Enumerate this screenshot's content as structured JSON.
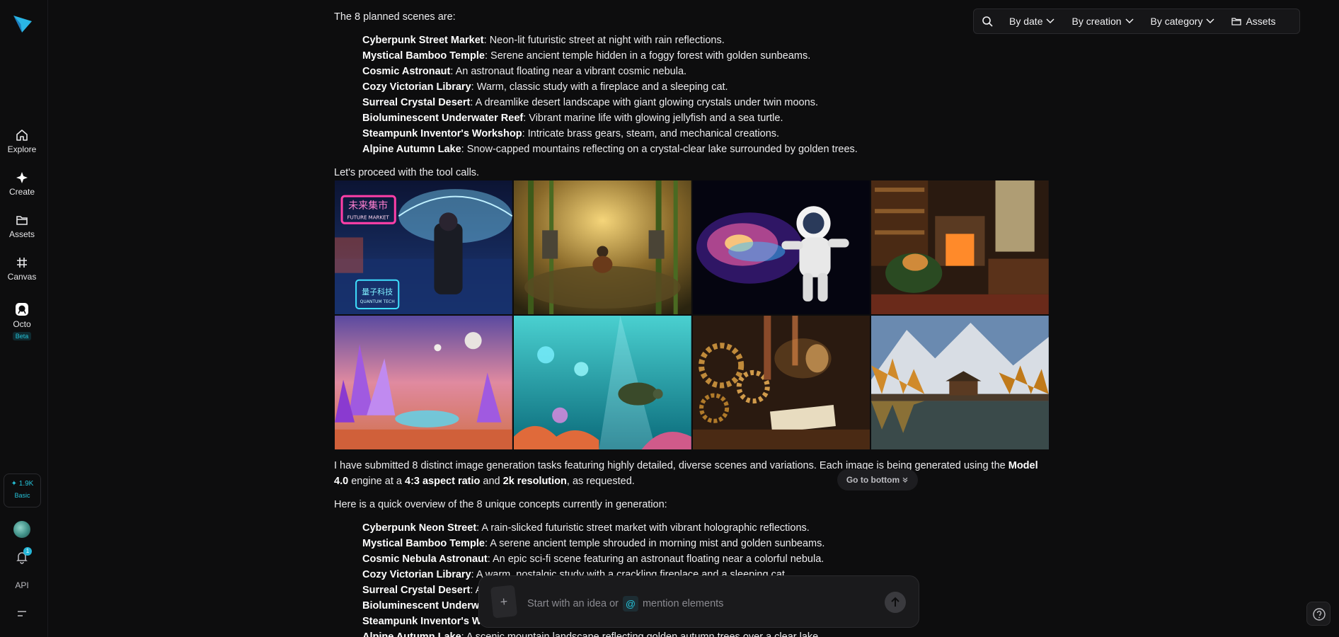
{
  "sidebar": {
    "nav": [
      {
        "label": "Explore",
        "icon": "home-icon"
      },
      {
        "label": "Create",
        "icon": "sparkle-icon"
      },
      {
        "label": "Assets",
        "icon": "folder-icon"
      },
      {
        "label": "Canvas",
        "icon": "frame-icon"
      },
      {
        "label": "Octo",
        "icon": "octo-icon",
        "badge": "Beta"
      }
    ],
    "credits": {
      "amount": "✦ 1.9K",
      "plan": "Basic"
    },
    "notifications_count": "1",
    "api_label": "API"
  },
  "toolbar": {
    "by_date": "By date",
    "by_creation": "By creation",
    "by_category": "By category",
    "assets": "Assets"
  },
  "chat": {
    "intro": "The 8 planned scenes are:",
    "planned": [
      {
        "title": "Cyberpunk Street Market",
        "desc": ": Neon-lit futuristic street at night with rain reflections."
      },
      {
        "title": "Mystical Bamboo Temple",
        "desc": ": Serene ancient temple hidden in a foggy forest with golden sunbeams."
      },
      {
        "title": "Cosmic Astronaut",
        "desc": ": An astronaut floating near a vibrant cosmic nebula."
      },
      {
        "title": "Cozy Victorian Library",
        "desc": ": Warm, classic study with a fireplace and a sleeping cat."
      },
      {
        "title": "Surreal Crystal Desert",
        "desc": ": A dreamlike desert landscape with giant glowing crystals under twin moons."
      },
      {
        "title": "Bioluminescent Underwater Reef",
        "desc": ": Vibrant marine life with glowing jellyfish and a sea turtle."
      },
      {
        "title": "Steampunk Inventor's Workshop",
        "desc": ": Intricate brass gears, steam, and mechanical creations."
      },
      {
        "title": "Alpine Autumn Lake",
        "desc": ": Snow-capped mountains reflecting on a crystal-clear lake surrounded by golden trees."
      }
    ],
    "proceed": "Let's proceed with the tool calls.",
    "submitted_1": "I have submitted 8 distinct image generation tasks featuring highly detailed, diverse scenes and variations. Each image is being generated using the ",
    "submitted_model": "Model",
    "submitted_model2": "4.0",
    "submitted_2": " engine at a ",
    "submitted_ratio": "4:3 aspect ratio",
    "submitted_3": " and ",
    "submitted_res": "2k resolution",
    "submitted_4": ", as requested.",
    "overview": "Here is a quick overview of the 8 unique concepts currently in generation:",
    "concepts": [
      {
        "title": "Cyberpunk Neon Street",
        "desc": ": A rain-slicked futuristic street market with vibrant holographic reflections."
      },
      {
        "title": "Mystical Bamboo Temple",
        "desc": ": A serene ancient temple shrouded in morning mist and golden sunbeams."
      },
      {
        "title": "Cosmic Nebula Astronaut",
        "desc": ": An epic sci-fi scene featuring an astronaut floating near a colorful nebula."
      },
      {
        "title": "Cozy Victorian Library",
        "desc": ": A warm, nostalgic study with a crackling fireplace and a sleeping cat."
      },
      {
        "title": "Surreal Crystal Desert",
        "desc": ": A"
      },
      {
        "title": "Bioluminescent Underw",
        "desc": ""
      },
      {
        "title": "Steampunk Inventor's Wo",
        "desc": ""
      },
      {
        "title": "Alpine Autumn Lake",
        "desc": ": A scenic mountain landscape reflecting golden autumn trees over a clear lake."
      }
    ],
    "image_text": {
      "sign_top": "未来集市",
      "sign_sub": "FUTURE MARKET",
      "sign_bottom": "量子科技",
      "sign_bottom_sub": "QUANTUM TECH"
    }
  },
  "goto_bottom": "Go to bottom",
  "prompt": {
    "placeholder_1": "Start with an idea or",
    "at": "@",
    "placeholder_2": "mention elements"
  },
  "colors": {
    "accent": "#25c2d8",
    "background": "#0d0d0e"
  }
}
